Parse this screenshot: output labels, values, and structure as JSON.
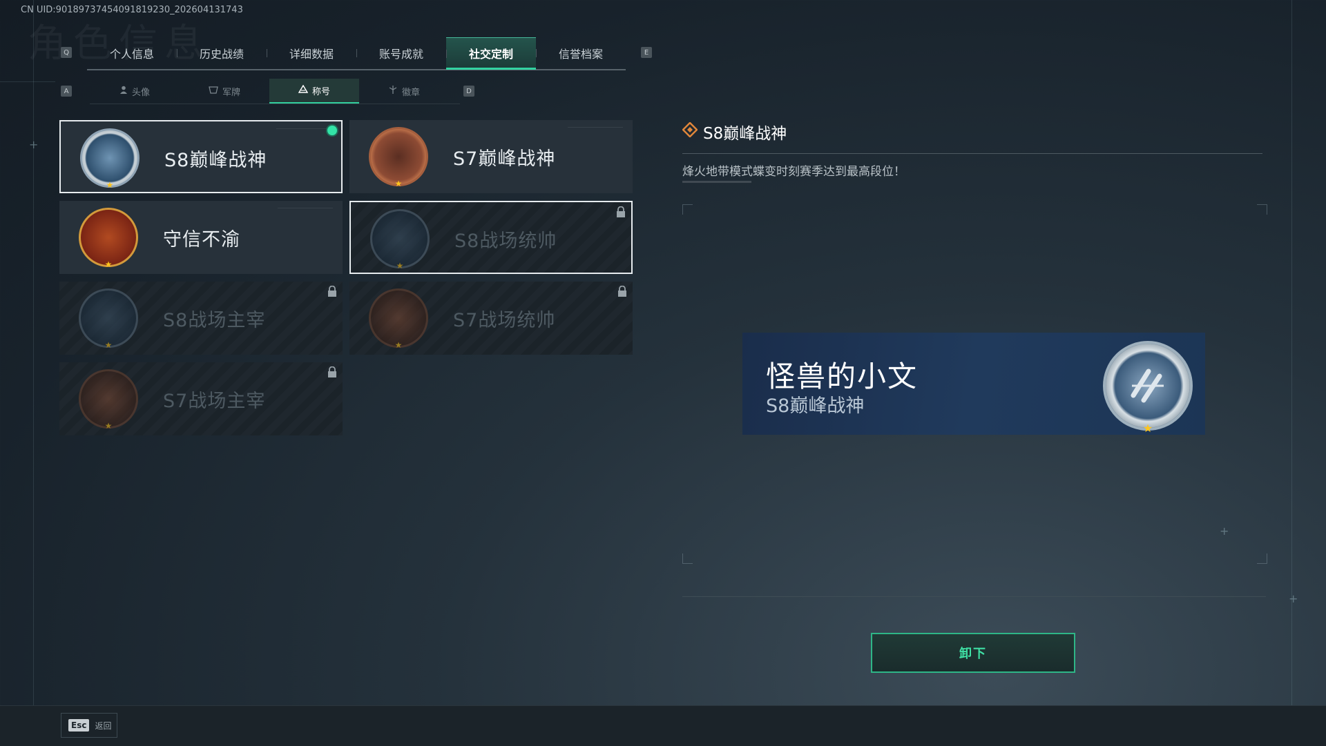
{
  "uid": "CN UID:9018973745409181923​0_202604131743",
  "bg_title": "角色信息",
  "tabs": [
    {
      "label": "个人信息",
      "active": false
    },
    {
      "label": "历史战绩",
      "active": false
    },
    {
      "label": "详细数据",
      "active": false
    },
    {
      "label": "账号成就",
      "active": false
    },
    {
      "label": "社交定制",
      "active": true
    },
    {
      "label": "信誉档案",
      "active": false
    }
  ],
  "tab_keys": {
    "left": "Q",
    "right": "E"
  },
  "subtab_keys": {
    "left": "A",
    "right": "D"
  },
  "subtabs": [
    {
      "label": "头像",
      "icon": "person-icon"
    },
    {
      "label": "军牌",
      "icon": "dogtag-icon"
    },
    {
      "label": "称号",
      "icon": "title-icon",
      "active": true
    },
    {
      "label": "徽章",
      "icon": "emblem-icon"
    }
  ],
  "titles": [
    {
      "label": "S8巅峰战神",
      "badge": "blue-wreath-badge",
      "selected": true,
      "equipped": true,
      "locked": false
    },
    {
      "label": "S7巅峰战神",
      "badge": "bronze-gun-badge",
      "selected": false,
      "equipped": false,
      "locked": false
    },
    {
      "label": "守信不渝",
      "badge": "scales-badge",
      "selected": false,
      "equipped": false,
      "locked": false
    },
    {
      "label": "S8战场统帅",
      "badge": "tank-badge",
      "selected": true,
      "equipped": false,
      "locked": true
    },
    {
      "label": "S8战场主宰",
      "badge": "building-badge",
      "selected": false,
      "equipped": false,
      "locked": true
    },
    {
      "label": "S7战场统帅",
      "badge": "vehicle-badge",
      "selected": false,
      "equipped": false,
      "locked": true
    },
    {
      "label": "S7战场主宰",
      "badge": "soldier-badge",
      "selected": false,
      "equipped": false,
      "locked": true
    }
  ],
  "detail": {
    "title": "S8巅峰战神",
    "description": "烽火地带模式蝶变时刻赛季达到最高段位！"
  },
  "banner": {
    "player_name": "怪兽的小文",
    "title": "S8巅峰战神"
  },
  "unequip_label": "卸下",
  "back": {
    "key": "Esc",
    "label": "返回"
  },
  "colors": {
    "accent": "#31d3a1",
    "star": "#ffc51c",
    "banner": "#1f3658"
  }
}
